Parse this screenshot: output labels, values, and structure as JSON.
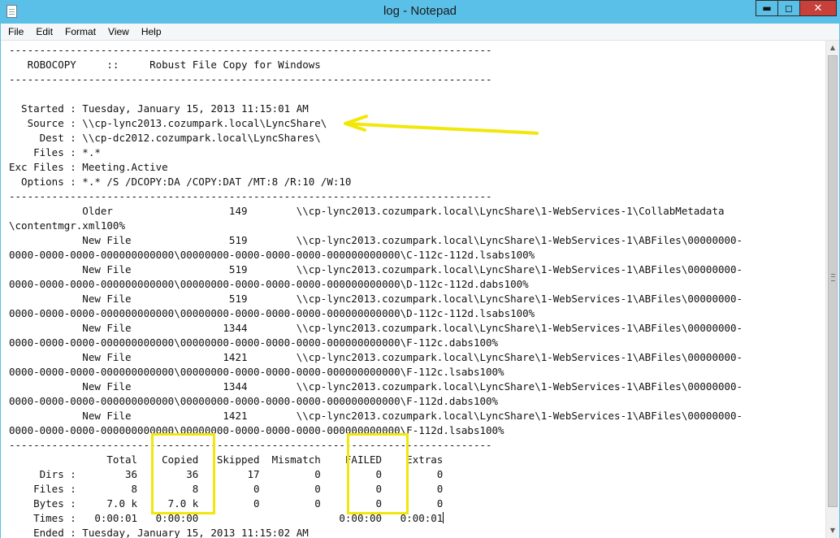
{
  "window": {
    "title": "log - Notepad",
    "controls": {
      "minimize": "▬",
      "maximize": "◻",
      "close": "✕"
    }
  },
  "menu": [
    "File",
    "Edit",
    "Format",
    "View",
    "Help"
  ],
  "document": {
    "lines": [
      "-------------------------------------------------------------------------------",
      "   ROBOCOPY     ::     Robust File Copy for Windows",
      "-------------------------------------------------------------------------------",
      "",
      "  Started : Tuesday, January 15, 2013 11:15:01 AM",
      "   Source : \\\\cp-lync2013.cozumpark.local\\LyncShare\\",
      "     Dest : \\\\cp-dc2012.cozumpark.local\\LyncShares\\",
      "    Files : *.*",
      "Exc Files : Meeting.Active",
      "  Options : *.* /S /DCOPY:DA /COPY:DAT /MT:8 /R:10 /W:10",
      "-------------------------------------------------------------------------------",
      "            Older                   149        \\\\cp-lync2013.cozumpark.local\\LyncShare\\1-WebServices-1\\CollabMetadata",
      "\\contentmgr.xml100%",
      "            New File                519        \\\\cp-lync2013.cozumpark.local\\LyncShare\\1-WebServices-1\\ABFiles\\00000000-",
      "0000-0000-0000-000000000000\\00000000-0000-0000-0000-000000000000\\C-112c-112d.lsabs100%",
      "            New File                519        \\\\cp-lync2013.cozumpark.local\\LyncShare\\1-WebServices-1\\ABFiles\\00000000-",
      "0000-0000-0000-000000000000\\00000000-0000-0000-0000-000000000000\\D-112c-112d.dabs100%",
      "            New File                519        \\\\cp-lync2013.cozumpark.local\\LyncShare\\1-WebServices-1\\ABFiles\\00000000-",
      "0000-0000-0000-000000000000\\00000000-0000-0000-0000-000000000000\\D-112c-112d.lsabs100%",
      "            New File               1344        \\\\cp-lync2013.cozumpark.local\\LyncShare\\1-WebServices-1\\ABFiles\\00000000-",
      "0000-0000-0000-000000000000\\00000000-0000-0000-0000-000000000000\\F-112c.dabs100%",
      "            New File               1421        \\\\cp-lync2013.cozumpark.local\\LyncShare\\1-WebServices-1\\ABFiles\\00000000-",
      "0000-0000-0000-000000000000\\00000000-0000-0000-0000-000000000000\\F-112c.lsabs100%",
      "            New File               1344        \\\\cp-lync2013.cozumpark.local\\LyncShare\\1-WebServices-1\\ABFiles\\00000000-",
      "0000-0000-0000-000000000000\\00000000-0000-0000-0000-000000000000\\F-112d.dabs100%",
      "            New File               1421        \\\\cp-lync2013.cozumpark.local\\LyncShare\\1-WebServices-1\\ABFiles\\00000000-",
      "0000-0000-0000-000000000000\\00000000-0000-0000-0000-000000000000\\F-112d.lsabs100%",
      "-------------------------------------------------------------------------------",
      "                Total    Copied   Skipped  Mismatch    FAILED    Extras",
      "     Dirs :        36        36        17         0         0         0",
      "    Files :         8         8         0         0         0         0",
      "    Bytes :     7.0 k     7.0 k         0         0         0         0",
      "    Times :   0:00:01   0:00:00                       0:00:00   0:00:01",
      "    Ended : Tuesday, January 15, 2013 11:15:02 AM"
    ]
  },
  "annotations": {
    "highlight_color": "#f2e70a"
  }
}
